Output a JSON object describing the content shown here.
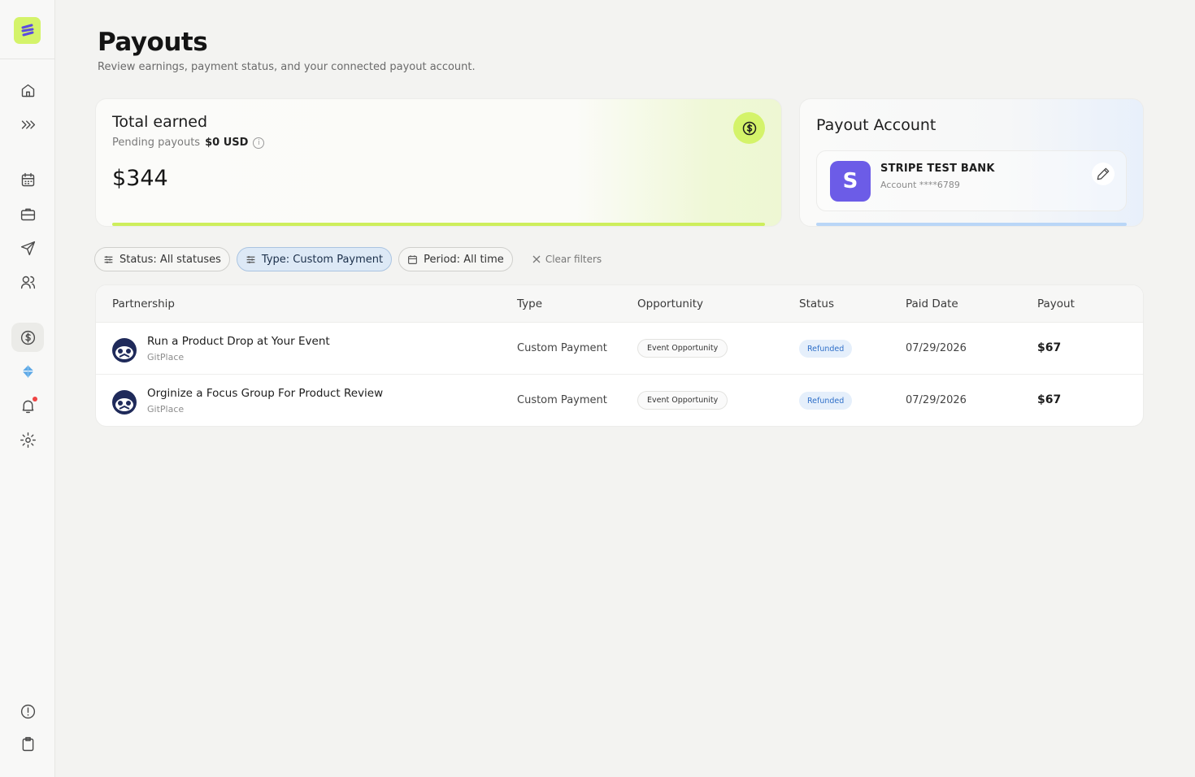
{
  "page": {
    "title": "Payouts",
    "subtitle": "Review earnings, payment status, and your connected payout account."
  },
  "sidebar": {
    "items": [
      {
        "name": "home-icon"
      },
      {
        "name": "deals-icon"
      },
      {
        "name": "calendar-icon"
      },
      {
        "name": "briefcase-icon"
      },
      {
        "name": "send-icon"
      },
      {
        "name": "users-icon"
      },
      {
        "name": "dollar-icon",
        "active": true
      },
      {
        "name": "diamond-icon"
      },
      {
        "name": "bell-icon",
        "badge": true
      },
      {
        "name": "gear-icon"
      }
    ],
    "bottom": [
      {
        "name": "alert-icon"
      },
      {
        "name": "clipboard-icon"
      }
    ]
  },
  "earned": {
    "title": "Total earned",
    "pending_label": "Pending payouts",
    "pending_amount": "$0 USD",
    "total": "$344"
  },
  "account": {
    "title": "Payout Account",
    "avatar_letter": "S",
    "bank_name": "STRIPE TEST BANK",
    "account_number": "Account ****6789"
  },
  "filters": {
    "status": "Status: All statuses",
    "type": "Type: Custom Payment",
    "period": "Period: All time",
    "clear": "Clear filters"
  },
  "table": {
    "headers": {
      "partnership": "Partnership",
      "type": "Type",
      "opportunity": "Opportunity",
      "status": "Status",
      "paid_date": "Paid Date",
      "payout": "Payout"
    },
    "rows": [
      {
        "title": "Run a Product Drop at Your Event",
        "org": "GitPlace",
        "type": "Custom Payment",
        "opportunity": "Event Opportunity",
        "status": "Refunded",
        "paid_date": "07/29/2026",
        "payout": "$67"
      },
      {
        "title": "Orginize a Focus Group For Product Review",
        "org": "GitPlace",
        "type": "Custom Payment",
        "opportunity": "Event Opportunity",
        "status": "Refunded",
        "paid_date": "07/29/2026",
        "payout": "$67"
      }
    ]
  },
  "colors": {
    "accent_lime": "#d4f36a",
    "account_bar": "#b9d6f7",
    "avatar_purple": "#6c5ce7",
    "status_blue": "#2f6fc8"
  }
}
